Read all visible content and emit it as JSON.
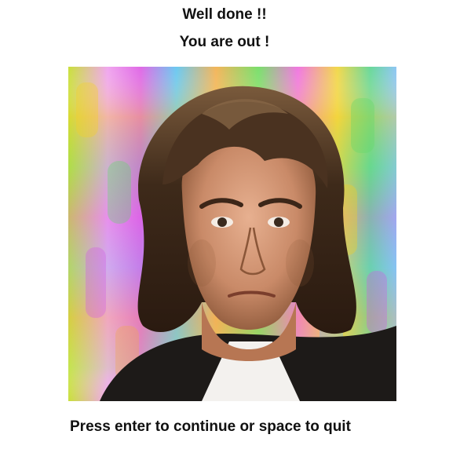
{
  "message": {
    "line1": "Well done !!",
    "line2": "You are out !"
  },
  "portrait": {
    "icon": "portrait-photo",
    "background_colors": [
      "#f5d021",
      "#62d96a",
      "#d45ae8",
      "#6fb8f2",
      "#f2a94e",
      "#b8f07a"
    ]
  },
  "prompt": {
    "text": "Press enter to continue or space to quit"
  }
}
